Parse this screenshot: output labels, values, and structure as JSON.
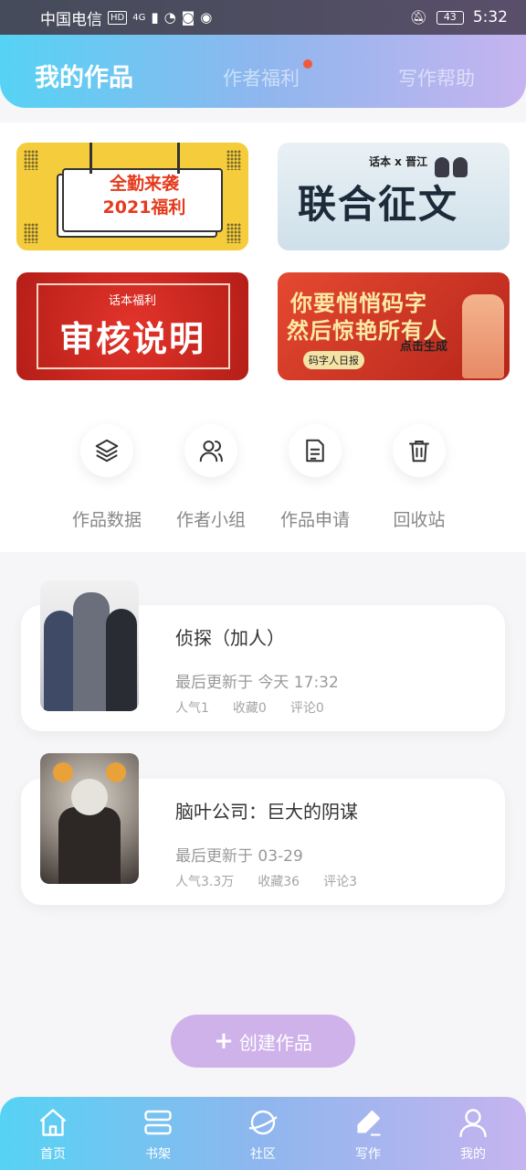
{
  "status_bar": {
    "carrier": "中国电信",
    "hd": "HD",
    "network": "4G",
    "battery": "43",
    "time": "5:32"
  },
  "header": {
    "tabs": [
      {
        "label": "我的作品",
        "active": true
      },
      {
        "label": "作者福利",
        "active": false,
        "has_dot": true
      },
      {
        "label": "写作帮助",
        "active": false
      }
    ]
  },
  "banners": [
    {
      "line1": "全勤来袭",
      "line2": "2021福利"
    },
    {
      "tag": "话本 x 晋江",
      "title": "联合征文"
    },
    {
      "sub": "话本福利",
      "title": "审核说明"
    },
    {
      "line1": "你要悄悄码字",
      "line2": "然后惊艳所有人",
      "small": "码字人日报",
      "click": "点击生成"
    }
  ],
  "actions": [
    {
      "label": "作品数据",
      "icon": "layers-icon"
    },
    {
      "label": "作者小组",
      "icon": "users-icon"
    },
    {
      "label": "作品申请",
      "icon": "document-icon"
    },
    {
      "label": "回收站",
      "icon": "trash-icon"
    }
  ],
  "works": [
    {
      "title": "侦探（加人）",
      "updated": "最后更新于 今天 17:32",
      "popularity": "人气1",
      "favorites": "收藏0",
      "comments": "评论0"
    },
    {
      "title": "脑叶公司：巨大的阴谋",
      "updated": "最后更新于 03-29",
      "popularity": "人气3.3万",
      "favorites": "收藏36",
      "comments": "评论3"
    }
  ],
  "create_button": {
    "label": "创建作品"
  },
  "bottom_nav": [
    {
      "label": "首页",
      "icon": "home-icon"
    },
    {
      "label": "书架",
      "icon": "bookshelf-icon"
    },
    {
      "label": "社区",
      "icon": "planet-icon"
    },
    {
      "label": "写作",
      "icon": "pen-icon",
      "active": true
    },
    {
      "label": "我的",
      "icon": "user-icon"
    }
  ],
  "colors": {
    "brand_start": "#56d3f4",
    "brand_end": "#c6b4ef",
    "create_button": "#cfb2ea",
    "notify_dot": "#ef5a3b"
  }
}
